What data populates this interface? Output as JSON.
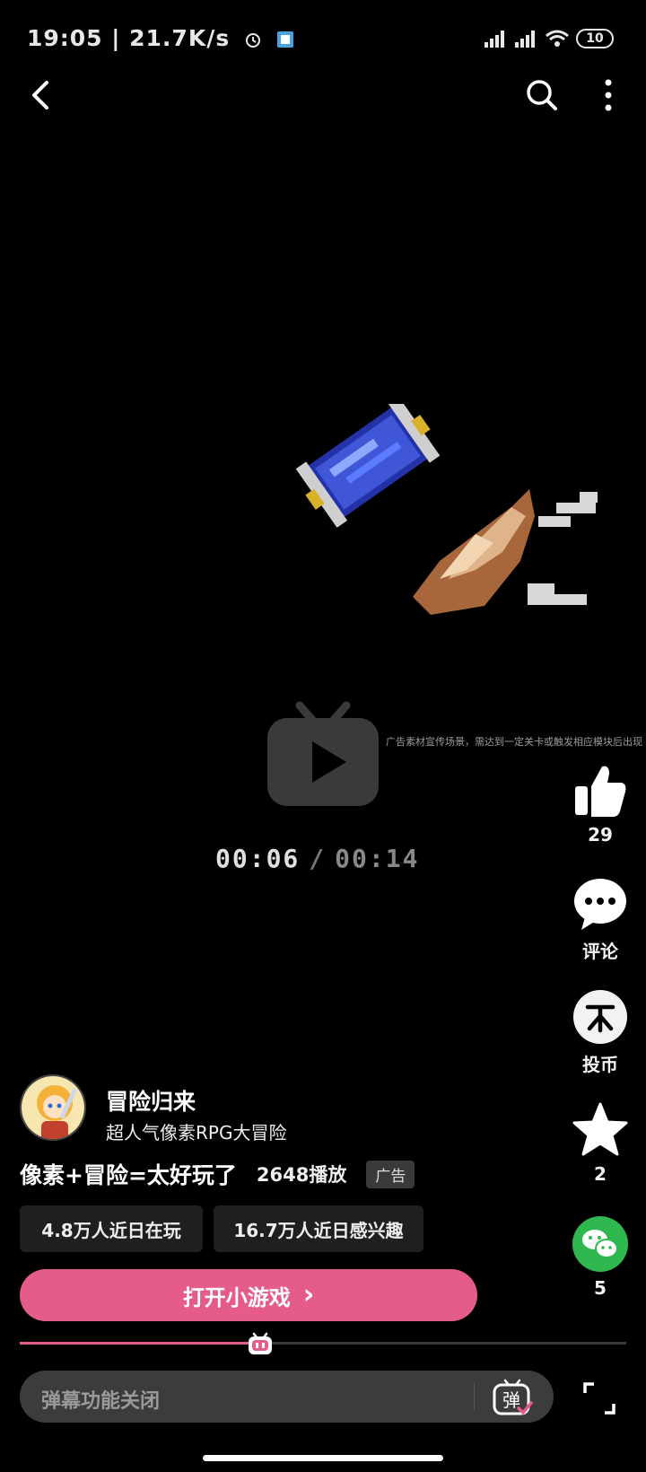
{
  "status_bar": {
    "time": "19:05",
    "net_speed": "21.7K/s",
    "battery": "10"
  },
  "video": {
    "overlay_caption": "广告素材宣传场景，需达到一定关卡或触发相应模块后出现",
    "time_current": "00:06",
    "time_separator": "/",
    "time_total": "00:14",
    "progress_fraction": 0.385
  },
  "actions": {
    "like_count": "29",
    "comment_label": "评论",
    "coin_label": "投币",
    "favorite_count": "2",
    "share_count": "5"
  },
  "game": {
    "name": "冒险归来",
    "description": "超人气像素RPG大冒险",
    "headline": "像素+冒险=太好玩了",
    "plays": "2648播放",
    "ad_badge": "广告",
    "stat_playing": "4.8万人近日在玩",
    "stat_interested": "16.7万人近日感兴趣",
    "open_button": "打开小游戏",
    "open_chevron": "›"
  },
  "danmaku": {
    "placeholder": "弹幕功能关闭",
    "toggle_glyph": "弹"
  },
  "colors": {
    "accent": "#e55c8a",
    "background": "#000000",
    "share_green": "#2fb84f"
  }
}
